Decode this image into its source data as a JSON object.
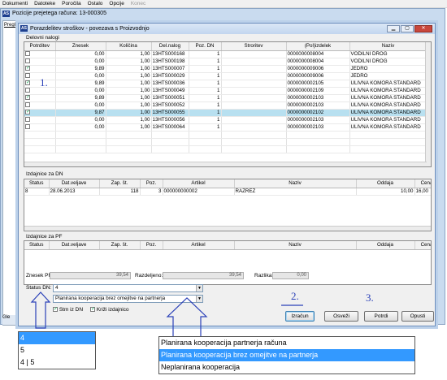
{
  "menubar": {
    "items": [
      {
        "label": "Dokumenti",
        "disabled": false
      },
      {
        "label": "Datoteke",
        "disabled": false
      },
      {
        "label": "Poročila",
        "disabled": false
      },
      {
        "label": "Ostalo",
        "disabled": false
      },
      {
        "label": "Opcije",
        "disabled": false
      },
      {
        "label": "Konec",
        "disabled": true
      }
    ]
  },
  "background_window": {
    "title": "Pozicije prejetega računa: 13-000305",
    "tab_label": "Pregle",
    "bottom_label": "Gle"
  },
  "app_icon_text": "AS",
  "dialog": {
    "title": "Porazdelitev stroškov - povezava s Proizvodnjo"
  },
  "delovni_nalogi": {
    "label": "Delovni nalogi",
    "headers": [
      "Potrditev",
      "Znesek",
      "Količina",
      "Del.nalog",
      "Poz. DN",
      "Stroritev",
      "(Pol)izdelek",
      "Naziv"
    ],
    "rows": [
      {
        "checked": false,
        "znesek": "0,00",
        "kolicina": "1,00",
        "nalog": "13HTS000168",
        "poz": "1",
        "stroritev": "",
        "izdelek": "0000000008004",
        "naziv": "VODILNI DROG",
        "selected": false
      },
      {
        "checked": false,
        "znesek": "0,00",
        "kolicina": "1,00",
        "nalog": "13HTS000198",
        "poz": "1",
        "stroritev": "",
        "izdelek": "0000000008004",
        "naziv": "VODILNI DROG",
        "selected": false
      },
      {
        "checked": true,
        "znesek": "9,89",
        "kolicina": "1,00",
        "nalog": "13HTS000007",
        "poz": "1",
        "stroritev": "",
        "izdelek": "0000000009006",
        "naziv": "JEDRO",
        "selected": false
      },
      {
        "checked": false,
        "znesek": "0,00",
        "kolicina": "1,00",
        "nalog": "13HTS000029",
        "poz": "1",
        "stroritev": "",
        "izdelek": "0000000009006",
        "naziv": "JEDRO",
        "selected": false
      },
      {
        "checked": true,
        "znesek": "9,89",
        "kolicina": "1,00",
        "nalog": "13HTS000036",
        "poz": "1",
        "stroritev": "",
        "izdelek": "0000000002105",
        "naziv": "ULIVNA KOMORA STANDARD",
        "selected": false
      },
      {
        "checked": false,
        "znesek": "0,00",
        "kolicina": "1,00",
        "nalog": "13HTS000049",
        "poz": "1",
        "stroritev": "",
        "izdelek": "0000000002109",
        "naziv": "ULIVNA KOMORA STANDARD",
        "selected": false
      },
      {
        "checked": true,
        "znesek": "9,89",
        "kolicina": "1,00",
        "nalog": "13HTS000051",
        "poz": "1",
        "stroritev": "",
        "izdelek": "0000000002103",
        "naziv": "ULIVNA KOMORA STANDARD",
        "selected": false
      },
      {
        "checked": false,
        "znesek": "0,00",
        "kolicina": "1,00",
        "nalog": "13HTS000052",
        "poz": "1",
        "stroritev": "",
        "izdelek": "0000000002103",
        "naziv": "ULIVNA KOMORA STANDARD",
        "selected": false
      },
      {
        "checked": true,
        "znesek": "9,87",
        "kolicina": "1,00",
        "nalog": "13HTS000055",
        "poz": "1",
        "stroritev": "",
        "izdelek": "0000000002102",
        "naziv": "ULIVNA KOMORA STANDARD",
        "selected": true
      },
      {
        "checked": false,
        "znesek": "0,00",
        "kolicina": "1,00",
        "nalog": "13HTS000056",
        "poz": "1",
        "stroritev": "",
        "izdelek": "0000000002103",
        "naziv": "ULIVNA KOMORA STANDARD",
        "selected": false
      },
      {
        "checked": false,
        "znesek": "0,00",
        "kolicina": "1,00",
        "nalog": "13HTS000064",
        "poz": "1",
        "stroritev": "",
        "izdelek": "0000000002103",
        "naziv": "ULIVNA KOMORA STANDARD",
        "selected": false
      }
    ]
  },
  "izdajnice_dn": {
    "label": "Izdajnice za DN",
    "headers": [
      "Status",
      "Dat.veljave",
      "Zap. št.",
      "Poz.",
      "Artikel",
      "Naziv",
      "Oddaja",
      "Cena"
    ],
    "rows": [
      {
        "status": "8",
        "datum": "28.06.2013",
        "zap": "118",
        "poz": "3",
        "artikel": "000000000002",
        "naziv": "RAZREZ",
        "oddaja": "10,00",
        "cena": "16,00"
      }
    ]
  },
  "izdajnice_pf": {
    "label": "Izdajnice za PF",
    "headers": [
      "Status",
      "Dat.veljave",
      "Zap. št.",
      "Poz.",
      "Artikel",
      "Naziv",
      "Oddaja",
      "Cena"
    ]
  },
  "totals": {
    "znesek_pf_label": "Znesek PF:",
    "znesek_pf": "39,54",
    "razdeljeno_label": "Razdeljeno:",
    "razdeljeno": "39,54",
    "razlika_label": "Razlika:",
    "razlika": "0,00"
  },
  "status_dn": {
    "label": "Status DN:",
    "value": "4"
  },
  "kooperacija_combo": {
    "value": "Planirana kooperacija brez omejitve na partnerja"
  },
  "checkboxes": {
    "stm_label": "Stm iz DN",
    "stm_checked": true,
    "krizi_label": "Križi izdajnico",
    "krizi_checked": true
  },
  "buttons": {
    "izracun": "Izračun",
    "osvezi": "Osveži",
    "potrdi": "Potrdi",
    "opusti": "Opusti"
  },
  "status_dropdown": {
    "options": [
      {
        "label": "4",
        "highlighted": true
      },
      {
        "label": "5",
        "highlighted": false
      },
      {
        "label": "4 | 5",
        "highlighted": false
      }
    ]
  },
  "kooperacija_dropdown": {
    "options": [
      {
        "label": "Planirana kooperacija partnerja računa",
        "highlighted": false
      },
      {
        "label": "Planirana kooperacija brez omejitve na partnerja",
        "highlighted": true
      },
      {
        "label": "Neplanirana kooperacija",
        "highlighted": false
      }
    ]
  },
  "annotations": {
    "a1": "1.",
    "a2": "2.",
    "a3": "3."
  },
  "colors": {
    "annotation": "#2b41b8",
    "selection": "#3399ff",
    "row_selected": "#b8e0f0"
  }
}
